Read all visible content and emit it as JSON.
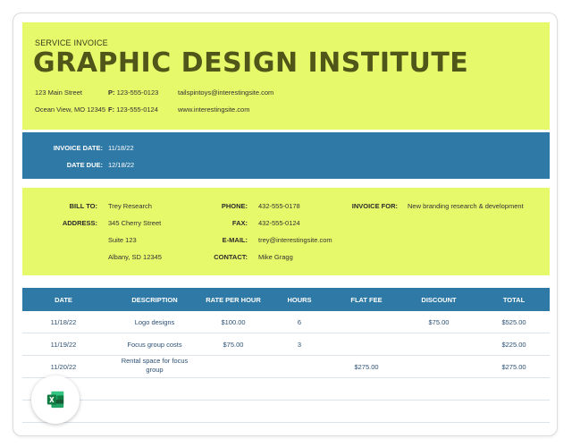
{
  "header": {
    "service_label": "SERVICE INVOICE",
    "title": "GRAPHIC DESIGN INSTITUTE",
    "address_line1": "123 Main Street",
    "address_line2": "Ocean View, MO 12345",
    "phone_label": "P:",
    "phone": "123-555-0123",
    "fax_label": "F:",
    "fax": "123-555-0124",
    "email": "tailspintoys@interestingsite.com",
    "website": "www.interestingsite.com"
  },
  "invoice": {
    "date_label": "INVOICE DATE:",
    "date": "11/18/22",
    "due_label": "DATE DUE:",
    "due": "12/18/22"
  },
  "bill_to": {
    "bill_label": "BILL TO:",
    "name": "Trey Research",
    "address_label": "ADDRESS:",
    "street": "345 Cherry Street",
    "suite": "Suite 123",
    "city": "Albany, SD 12345",
    "phone_label": "PHONE:",
    "phone": "432-555-0178",
    "fax_label": "FAX:",
    "fax": "432-555-0124",
    "email_label": "E-MAIL:",
    "email": "trey@interestingsite.com",
    "contact_label": "CONTACT:",
    "contact": "Mike Gragg",
    "invoice_for_label": "INVOICE FOR:",
    "invoice_for": "New branding research & development"
  },
  "table": {
    "headers": [
      "DATE",
      "DESCRIPTION",
      "RATE PER HOUR",
      "HOURS",
      "FLAT FEE",
      "DISCOUNT",
      "TOTAL"
    ],
    "rows": [
      {
        "date": "11/18/22",
        "desc1": "Logo designs",
        "desc2": "",
        "rate": "$100.00",
        "hours": "6",
        "flat": "",
        "discount": "$75.00",
        "total": "$525.00"
      },
      {
        "date": "11/19/22",
        "desc1": "Focus group costs",
        "desc2": "",
        "rate": "$75.00",
        "hours": "3",
        "flat": "",
        "discount": "",
        "total": "$225.00"
      },
      {
        "date": "11/20/22",
        "desc1": "Rental space for focus",
        "desc2": "group",
        "rate": "",
        "hours": "",
        "flat": "$275.00",
        "discount": "",
        "total": "$275.00"
      }
    ]
  },
  "colors": {
    "lime": "#e6f96a",
    "blue": "#2f79a6",
    "title_olive": "#4e5619",
    "excel_green": "#1e7145"
  },
  "badge": {
    "icon": "excel-icon"
  }
}
